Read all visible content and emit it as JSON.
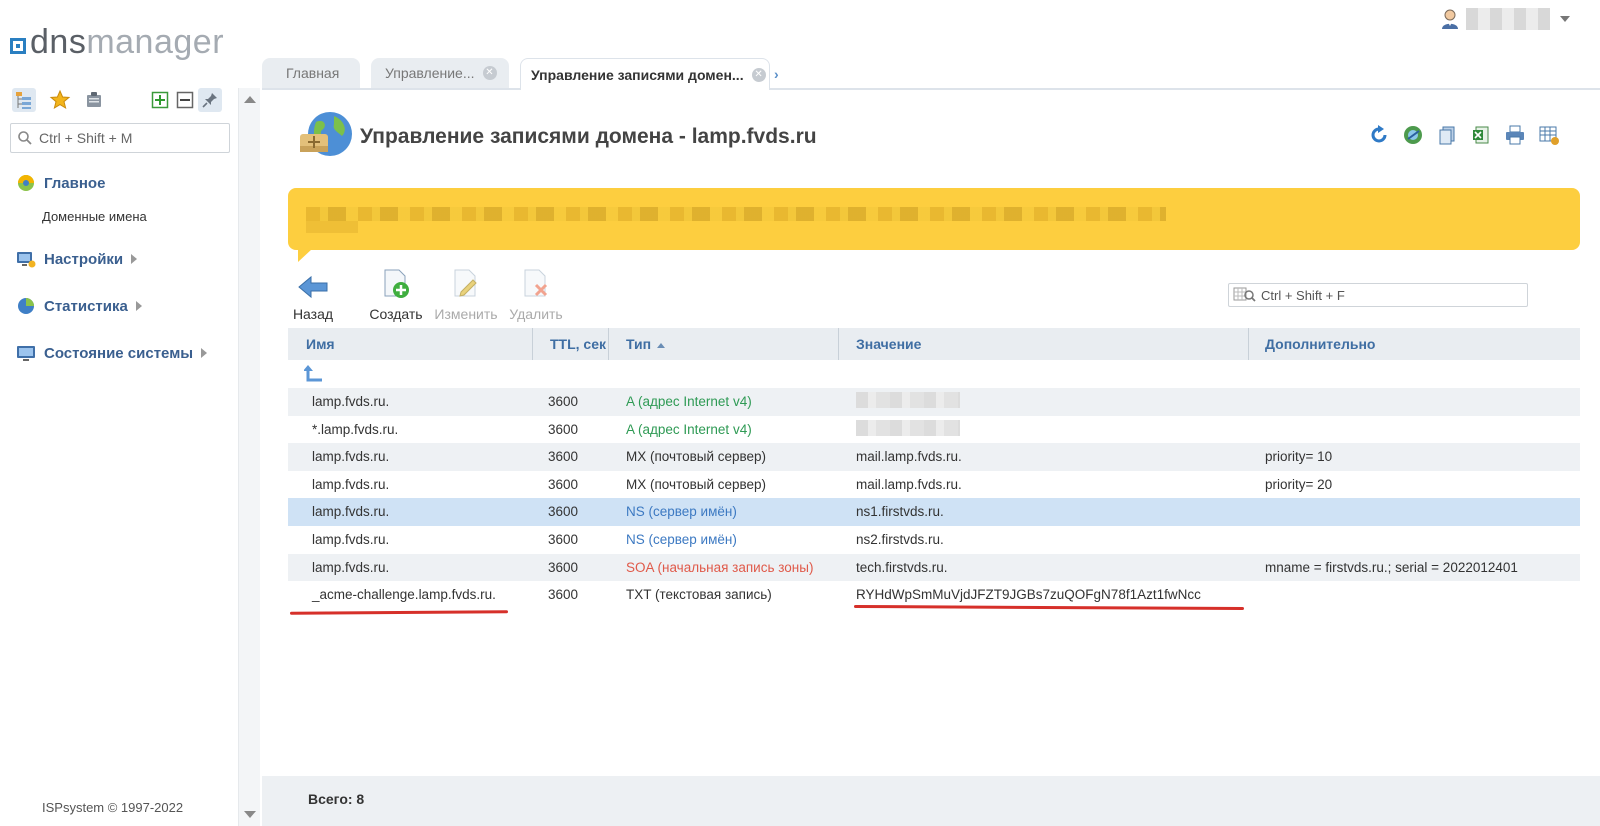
{
  "logo": {
    "part1": "dns",
    "part2": "manager"
  },
  "sidebar": {
    "search_placeholder": "Ctrl + Shift + M",
    "groups": [
      {
        "label": "Главное",
        "sub": [
          "Доменные имена"
        ]
      },
      {
        "label": "Настройки"
      },
      {
        "label": "Статистика"
      },
      {
        "label": "Состояние системы"
      }
    ],
    "copyright": "ISPsystem © 1997-2022"
  },
  "tabs": [
    {
      "label": "Главная"
    },
    {
      "label": "Управление..."
    },
    {
      "label": "Управление записями домен..."
    }
  ],
  "page": {
    "title": "Управление записями домена - lamp.fvds.ru"
  },
  "toolbar": {
    "back": "Назад",
    "create": "Создать",
    "edit": "Изменить",
    "delete": "Удалить"
  },
  "grid_search_placeholder": "Ctrl + Shift + F",
  "table": {
    "headers": {
      "name": "Имя",
      "ttl": "TTL, сек",
      "type": "Тип",
      "value": "Значение",
      "extra": "Дополнительно"
    },
    "rows": [
      {
        "name": "lamp.fvds.ru.",
        "ttl": "3600",
        "type": "A (адрес Internet v4)",
        "value": "",
        "extra": ""
      },
      {
        "name": "*.lamp.fvds.ru.",
        "ttl": "3600",
        "type": "A (адрес Internet v4)",
        "value": "",
        "extra": ""
      },
      {
        "name": "lamp.fvds.ru.",
        "ttl": "3600",
        "type": "MX (почтовый сервер)",
        "value": "mail.lamp.fvds.ru.",
        "extra": "priority= 10"
      },
      {
        "name": "lamp.fvds.ru.",
        "ttl": "3600",
        "type": "MX (почтовый сервер)",
        "value": "mail.lamp.fvds.ru.",
        "extra": "priority= 20"
      },
      {
        "name": "lamp.fvds.ru.",
        "ttl": "3600",
        "type": "NS (сервер имён)",
        "value": "ns1.firstvds.ru.",
        "extra": ""
      },
      {
        "name": "lamp.fvds.ru.",
        "ttl": "3600",
        "type": "NS (сервер имён)",
        "value": "ns2.firstvds.ru.",
        "extra": ""
      },
      {
        "name": "lamp.fvds.ru.",
        "ttl": "3600",
        "type": "SOA (начальная запись зоны)",
        "value": "tech.firstvds.ru.",
        "extra": "mname = firstvds.ru.; serial = 2022012401"
      },
      {
        "name": "_acme-challenge.lamp.fvds.ru.",
        "ttl": "3600",
        "type": "TXT (текстовая запись)",
        "value": "RYHdWpSmMuVjdJFZT9JGBs7zuQOFgN78f1Azt1fwNcc",
        "extra": ""
      }
    ]
  },
  "footer": {
    "total": "Всего: 8"
  }
}
